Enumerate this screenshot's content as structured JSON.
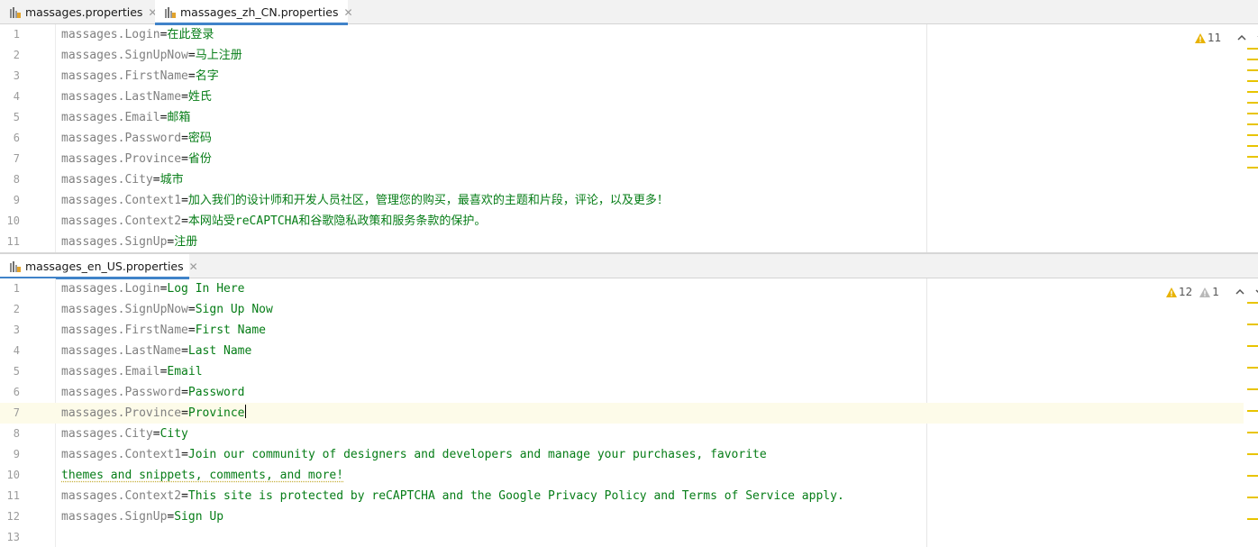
{
  "top": {
    "tabs": [
      {
        "label": "massages.properties",
        "active": false
      },
      {
        "label": "massages_zh_CN.properties",
        "active": true
      }
    ],
    "inspection": {
      "warnings": "11",
      "weak_warnings": ""
    },
    "lines": [
      {
        "n": "1",
        "key": "massages.Login",
        "eq": "=",
        "val": "在此登录"
      },
      {
        "n": "2",
        "key": "massages.SignUpNow",
        "eq": "=",
        "val": "马上注册"
      },
      {
        "n": "3",
        "key": "massages.FirstName",
        "eq": "=",
        "val": "名字"
      },
      {
        "n": "4",
        "key": "massages.LastName",
        "eq": "=",
        "val": "姓氏"
      },
      {
        "n": "5",
        "key": "massages.Email",
        "eq": "=",
        "val": "邮箱"
      },
      {
        "n": "6",
        "key": "massages.Password",
        "eq": "=",
        "val": "密码"
      },
      {
        "n": "7",
        "key": "massages.Province",
        "eq": "=",
        "val": "省份"
      },
      {
        "n": "8",
        "key": "massages.City",
        "eq": "=",
        "val": "城市"
      },
      {
        "n": "9",
        "key": "massages.Context1",
        "eq": "=",
        "val": "加入我们的设计师和开发人员社区，管理您的购买，最喜欢的主题和片段，评论，以及更多！"
      },
      {
        "n": "10",
        "key": "massages.Context2",
        "eq": "=",
        "val": "本网站受reCAPTCHA和谷歌隐私政策和服务条款的保护。"
      },
      {
        "n": "11",
        "key": "massages.SignUp",
        "eq": "=",
        "val": "注册"
      }
    ]
  },
  "bottom": {
    "tabs": [
      {
        "label": "massages_en_US.properties",
        "active": true
      }
    ],
    "inspection": {
      "warnings": "12",
      "weak_warnings": "1"
    },
    "lines": [
      {
        "n": "1",
        "key": "massages.Login",
        "eq": "=",
        "val": "Log In Here"
      },
      {
        "n": "2",
        "key": "massages.SignUpNow",
        "eq": "=",
        "val": "Sign Up Now"
      },
      {
        "n": "3",
        "key": "massages.FirstName",
        "eq": "=",
        "val": "First Name"
      },
      {
        "n": "4",
        "key": "massages.LastName",
        "eq": "=",
        "val": "Last Name"
      },
      {
        "n": "5",
        "key": "massages.Email",
        "eq": "=",
        "val": "Email"
      },
      {
        "n": "6",
        "key": "massages.Password",
        "eq": "=",
        "val": "Password"
      },
      {
        "n": "7",
        "key": "massages.Province",
        "eq": "=",
        "val": "Province",
        "current": true
      },
      {
        "n": "8",
        "key": "massages.City",
        "eq": "=",
        "val": "City"
      },
      {
        "n": "9",
        "key": "massages.Context1",
        "eq": "=",
        "val": "Join our community of designers and developers and manage your purchases, favorite"
      },
      {
        "n": "10",
        "key": "",
        "eq": "",
        "val": "themes and snippets, comments, and more!",
        "typo": true
      },
      {
        "n": "11",
        "key": "massages.Context2",
        "eq": "=",
        "val": "This site is protected by reCAPTCHA and the Google Privacy Policy and Terms of Service apply."
      },
      {
        "n": "12",
        "key": "massages.SignUp",
        "eq": "=",
        "val": "Sign Up"
      },
      {
        "n": "13",
        "key": "",
        "eq": "",
        "val": ""
      }
    ]
  },
  "colors": {
    "key": "#808080",
    "value": "#067d17",
    "warning": "#e8c400",
    "active_tab_underline": "#4083c9"
  }
}
